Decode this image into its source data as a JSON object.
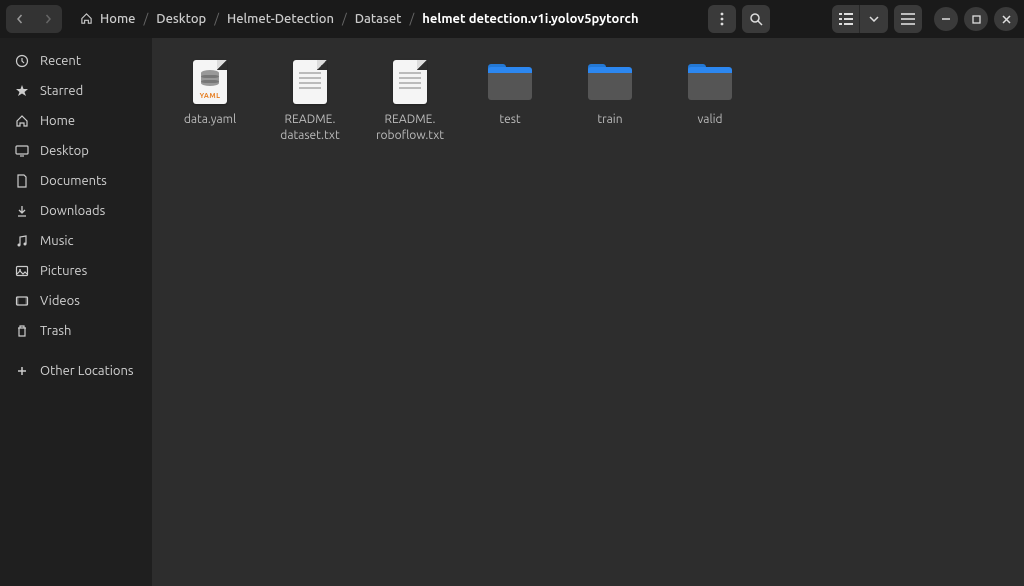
{
  "breadcrumbs": [
    {
      "label": "Home",
      "icon": true
    },
    {
      "label": "Desktop"
    },
    {
      "label": "Helmet-Detection"
    },
    {
      "label": "Dataset"
    },
    {
      "label": "helmet detection.v1i.yolov5pytorch",
      "current": true
    }
  ],
  "sidebar": {
    "items": [
      {
        "label": "Recent",
        "icon": "clock"
      },
      {
        "label": "Starred",
        "icon": "star"
      },
      {
        "label": "Home",
        "icon": "home"
      },
      {
        "label": "Desktop",
        "icon": "desktop"
      },
      {
        "label": "Documents",
        "icon": "document"
      },
      {
        "label": "Downloads",
        "icon": "download"
      },
      {
        "label": "Music",
        "icon": "music"
      },
      {
        "label": "Pictures",
        "icon": "picture"
      },
      {
        "label": "Videos",
        "icon": "video"
      },
      {
        "label": "Trash",
        "icon": "trash"
      }
    ],
    "other": {
      "label": "Other Locations",
      "icon": "plus"
    }
  },
  "files": [
    {
      "name": "data.yaml",
      "type": "yaml"
    },
    {
      "name": "README.\ndataset.txt",
      "type": "txt"
    },
    {
      "name": "README.\nroboflow.txt",
      "type": "txt"
    },
    {
      "name": "test",
      "type": "folder"
    },
    {
      "name": "train",
      "type": "folder"
    },
    {
      "name": "valid",
      "type": "folder"
    }
  ],
  "yaml_badge": "YAML"
}
